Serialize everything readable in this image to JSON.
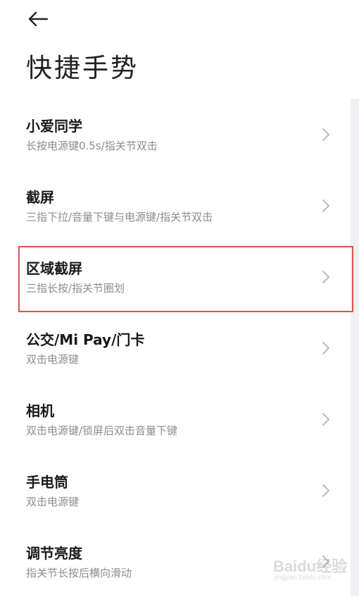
{
  "header": {
    "back_icon": "arrow-left-icon",
    "title": "快捷手势"
  },
  "items": [
    {
      "title": "小爱同学",
      "subtitle": "长按电源键0.5s/指关节双击",
      "icon": "chevron-right-icon",
      "highlighted": false
    },
    {
      "title": "截屏",
      "subtitle": "三指下拉/音量下键与电源键/指关节双击",
      "icon": "chevron-right-icon",
      "highlighted": false
    },
    {
      "title": "区域截屏",
      "subtitle": "三指长按/指关节圈划",
      "icon": "chevron-right-icon",
      "highlighted": true
    },
    {
      "title": "公交/Mi Pay/门卡",
      "subtitle": "双击电源键",
      "icon": "chevron-right-icon",
      "highlighted": false
    },
    {
      "title": "相机",
      "subtitle": "双击电源键/锁屏后双击音量下键",
      "icon": "chevron-right-icon",
      "highlighted": false
    },
    {
      "title": "手电筒",
      "subtitle": "双击电源键",
      "icon": "chevron-right-icon",
      "highlighted": false
    },
    {
      "title": "调节亮度",
      "subtitle": "指关节长按后横向滑动",
      "icon": "chevron-right-icon",
      "highlighted": false
    }
  ],
  "highlight_color": "#d9534f",
  "watermark": {
    "text": "Baidu经验",
    "sub": "jingyan.baidu.com"
  }
}
